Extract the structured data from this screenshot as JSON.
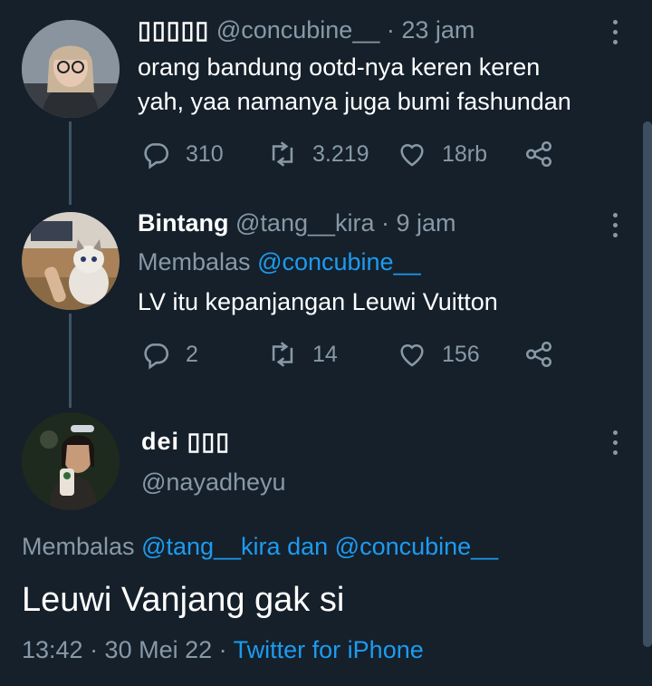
{
  "tweets": [
    {
      "name": "▯▯▯▯▯",
      "handle": "@concubine__",
      "time": "· 23 jam",
      "text_lines": [
        "orang bandung ootd-nya keren keren",
        "yah, yaa namanya juga bumi fashundan"
      ],
      "replies": "310",
      "retweets": "3.219",
      "likes": "18rb"
    },
    {
      "name": "Bintang",
      "handle": "@tang__kira",
      "time": "· 9 jam",
      "reply_prefix": "Membalas",
      "reply_to": "@concubine__",
      "text": "LV itu kepanjangan Leuwi Vuitton",
      "replies": "2",
      "retweets": "14",
      "likes": "156"
    }
  ],
  "main_tweet": {
    "name": "dei ▯▯▯",
    "handle": "@nayadheyu",
    "reply_prefix": "Membalas",
    "reply_to_1": "@tang__kira",
    "reply_and": "dan",
    "reply_to_2": "@concubine__",
    "text": "Leuwi Vanjang gak si",
    "timestamp": "13:42 · 30 Mei 22 ·",
    "source": "Twitter for iPhone"
  },
  "colors": {
    "background": "#15202b",
    "muted": "#8899a6",
    "link": "#1d9bf0",
    "thread_line": "#3d5466"
  }
}
